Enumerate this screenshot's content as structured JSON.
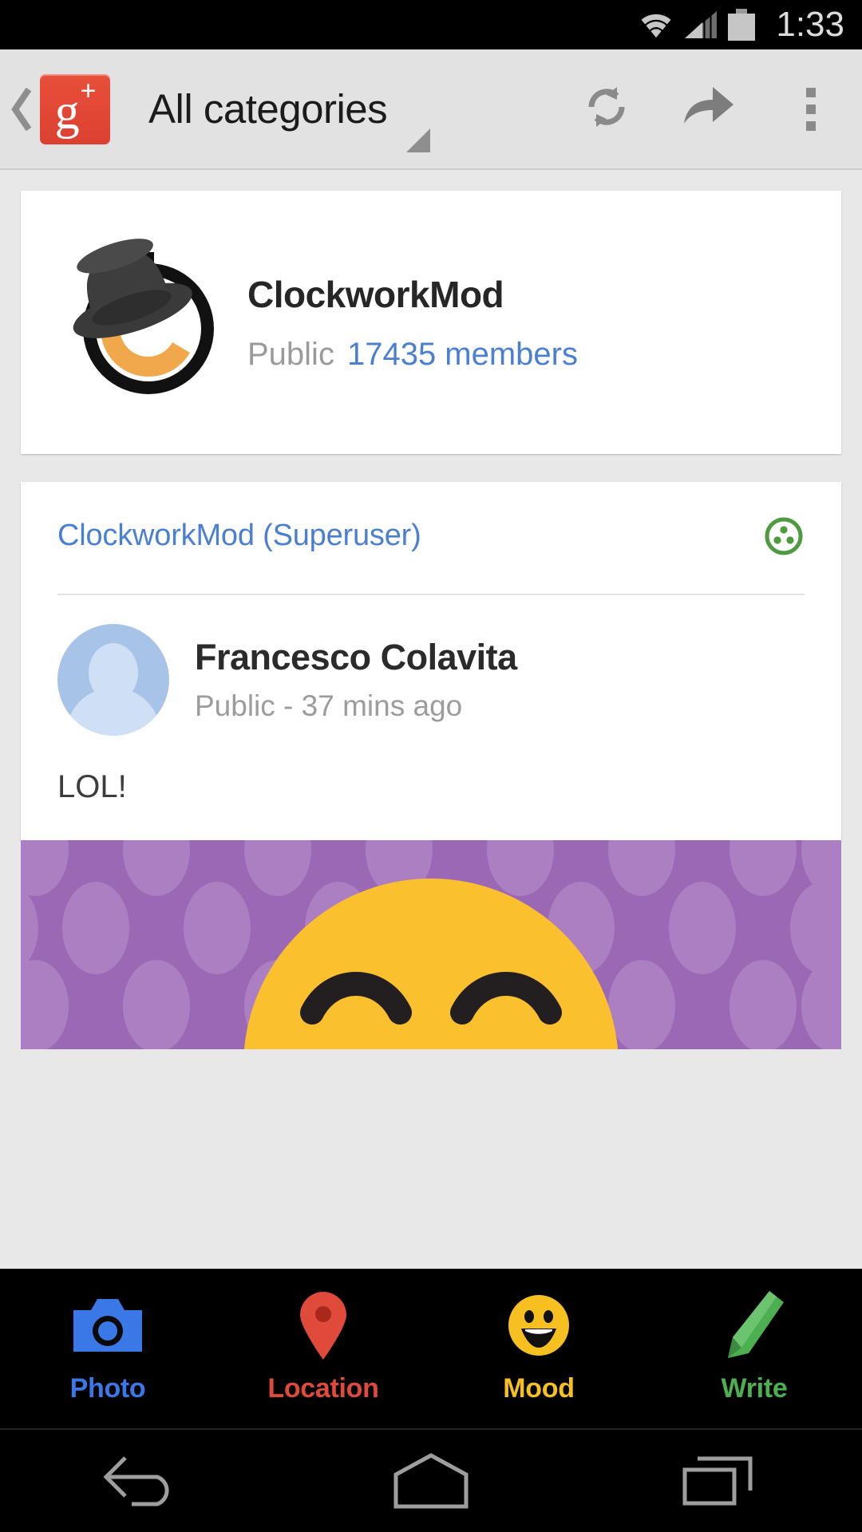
{
  "statusbar": {
    "time": "1:33",
    "icons": [
      "wifi-icon",
      "cell-signal-icon",
      "battery-icon"
    ]
  },
  "actionbar": {
    "back_icon": "back-chevron-icon",
    "app_logo": "google-plus-logo",
    "logo_letter": "g",
    "logo_plus": "+",
    "title": "All categories",
    "dropdown_icon": "dropdown-triangle-icon",
    "refresh_label": "Refresh",
    "refresh_icon": "refresh-icon",
    "share_label": "Share",
    "share_icon": "share-arrow-icon",
    "overflow_label": "More options",
    "overflow_icon": "overflow-menu-icon"
  },
  "community": {
    "avatar_icon": "clockworkmod-logo",
    "name": "ClockworkMod",
    "visibility": "Public",
    "members": "17435 members"
  },
  "post": {
    "source_link": "ClockworkMod (Superuser)",
    "audience_icon": "community-circle-icon",
    "audience_color": "#4e9a3e",
    "author_avatar_icon": "default-avatar-icon",
    "author_name": "Francesco Colavita",
    "author_meta": "Public - 37 mins ago",
    "body_text": "LOL!",
    "attachment": {
      "type": "image",
      "alt": "grinning-face-emoji",
      "background_color": "#9a68b4",
      "dot_color": "#ac7ec2",
      "emoji_color": "#fbc02d"
    }
  },
  "toolbar": {
    "items": [
      {
        "label": "Photo",
        "icon": "camera-icon",
        "color": "#3b78e7"
      },
      {
        "label": "Location",
        "icon": "map-pin-icon",
        "color": "#e04a3a"
      },
      {
        "label": "Mood",
        "icon": "smiley-icon",
        "color": "#f5c020"
      },
      {
        "label": "Write",
        "icon": "pencil-icon",
        "color": "#4caf50"
      }
    ]
  },
  "navbar": {
    "back": "back-nav-icon",
    "home": "home-nav-icon",
    "recents": "recents-nav-icon"
  }
}
